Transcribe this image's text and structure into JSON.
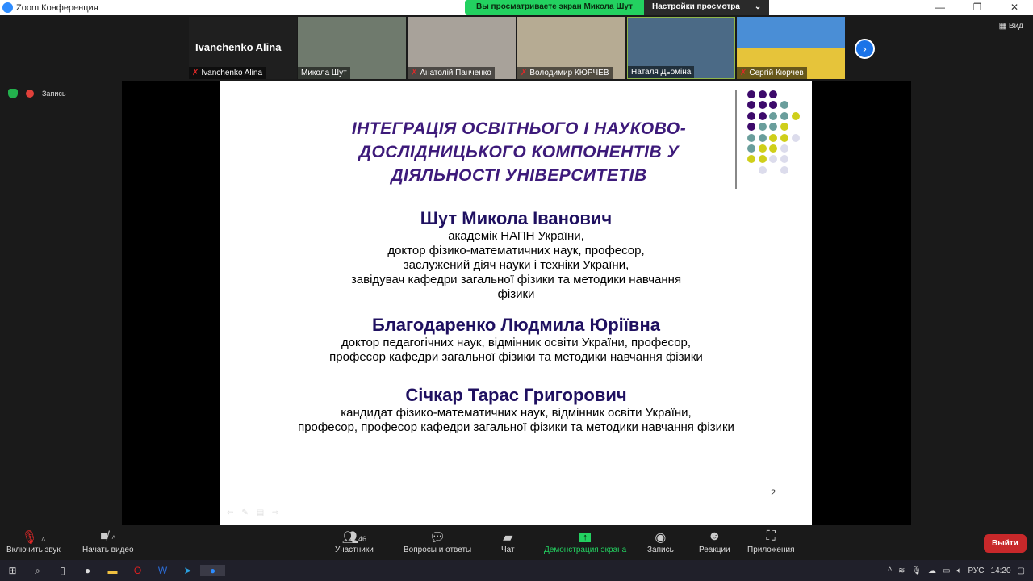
{
  "window": {
    "title": "Zoom Конференция"
  },
  "banner": {
    "viewing": "Вы просматриваете экран Микола Шут",
    "view_options": "Настройки просмотра"
  },
  "participants": [
    {
      "name": "Ivanchenko Alina",
      "muted": true,
      "video": false
    },
    {
      "name": "Микола Шут",
      "muted": false
    },
    {
      "name": "Анатолій Панченко",
      "muted": true
    },
    {
      "name": "Володимир КЮРЧЕВ",
      "muted": true
    },
    {
      "name": "Наталя Дьоміна",
      "muted": false
    },
    {
      "name": "Сергій Кюрчев",
      "muted": true
    }
  ],
  "view_label": "Вид",
  "record_status": "Запись",
  "slide": {
    "title": "ІНТЕГРАЦІЯ ОСВІТНЬОГО І НАУКОВО-ДОСЛІДНИЦЬКОГО КОМПОНЕНТІВ У ДІЯЛЬНОСТІ УНІВЕРСИТЕТІВ",
    "people": [
      {
        "name": "Шут Микола Іванович",
        "lines": [
          "академік НАПН України,",
          "доктор фізико-математичних наук, професор,",
          "заслужений діяч науки і техніки України,",
          "завідувач кафедри загальної фізики та методики навчання",
          "фізики"
        ]
      },
      {
        "name": "Благодаренко Людмила Юріївна",
        "lines": [
          "доктор педагогічних наук, відмінник освіти України, професор,",
          "професор кафедри загальної фізики та методики навчання фізики"
        ]
      },
      {
        "name": "Січкар Тарас Григорович",
        "lines": [
          "кандидат фізико-математичних наук, відмінник освіти України,",
          "професор, професор кафедри загальної фізики та методики навчання фізики"
        ]
      }
    ],
    "page": "2",
    "colors": {
      "purple": "#3d0a6b",
      "teal": "#6a9e9c",
      "yellow": "#cfcf1a",
      "lilac": "#dcdcec"
    }
  },
  "toolbar": {
    "unmute": "Включить звук",
    "start_video": "Начать видео",
    "participants": "Участники",
    "participants_count": "46",
    "qa": "Вопросы и ответы",
    "chat": "Чат",
    "share": "Демонстрация экрана",
    "record": "Запись",
    "reactions": "Реакции",
    "apps": "Приложения",
    "leave": "Выйти"
  },
  "taskbar": {
    "lang": "РУС",
    "time": "14:20"
  }
}
